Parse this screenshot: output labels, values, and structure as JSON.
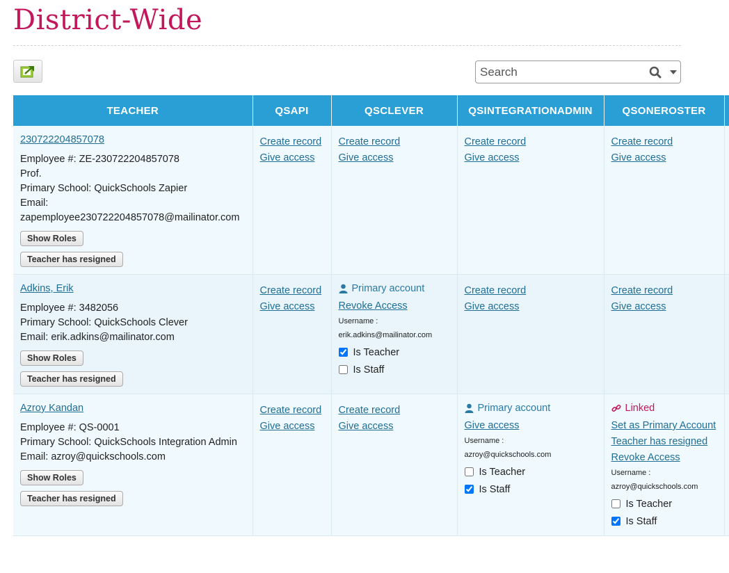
{
  "page": {
    "title": "District-Wide"
  },
  "search": {
    "placeholder": "Search"
  },
  "icons": {
    "export": "export-icon",
    "search": "search-icon",
    "dropdown": "chevron-down-icon",
    "user": "user-icon",
    "link": "link-icon"
  },
  "colors": {
    "header_bg": "#2a9fd6",
    "title": "#c2185b",
    "link": "#1f6e96",
    "linked": "#c2185b"
  },
  "columns": [
    "TEACHER",
    "QSAPI",
    "QSCLEVER",
    "QSINTEGRATIONADMIN",
    "QSONEROSTER"
  ],
  "common": {
    "create_record": "Create record",
    "give_access": "Give access",
    "show_roles": "Show Roles",
    "teacher_resigned": "Teacher has resigned",
    "primary_account": "Primary account",
    "revoke_access": "Revoke Access",
    "username_label": "Username :",
    "is_teacher": "Is Teacher",
    "is_staff": "Is Staff",
    "linked": "Linked",
    "set_primary": "Set as Primary Account"
  },
  "rows": [
    {
      "name": "230722204857078",
      "details": [
        "Employee #: ZE-230722204857078",
        "Prof.",
        "Primary School: QuickSchools Zapier",
        "Email:",
        "zapemployee230722204857078@mailinator.com"
      ]
    },
    {
      "name": "Adkins, Erik",
      "details": [
        "Employee #: 3482056",
        "Primary School: QuickSchools Clever",
        "Email: erik.adkins@mailinator.com"
      ],
      "qsclever_username": "erik.adkins@mailinator.com",
      "qsclever_is_teacher": true,
      "qsclever_is_staff": false
    },
    {
      "name": "Azroy Kandan",
      "details": [
        "Employee #: QS-0001",
        "Primary School: QuickSchools Integration Admin",
        "Email: azroy@quickschools.com"
      ],
      "qsia_username": "azroy@quickschools.com",
      "qsia_is_teacher": false,
      "qsia_is_staff": true,
      "qsoneroster_username": "azroy@quickschools.com",
      "qsoneroster_is_teacher": false,
      "qsoneroster_is_staff": true
    }
  ]
}
